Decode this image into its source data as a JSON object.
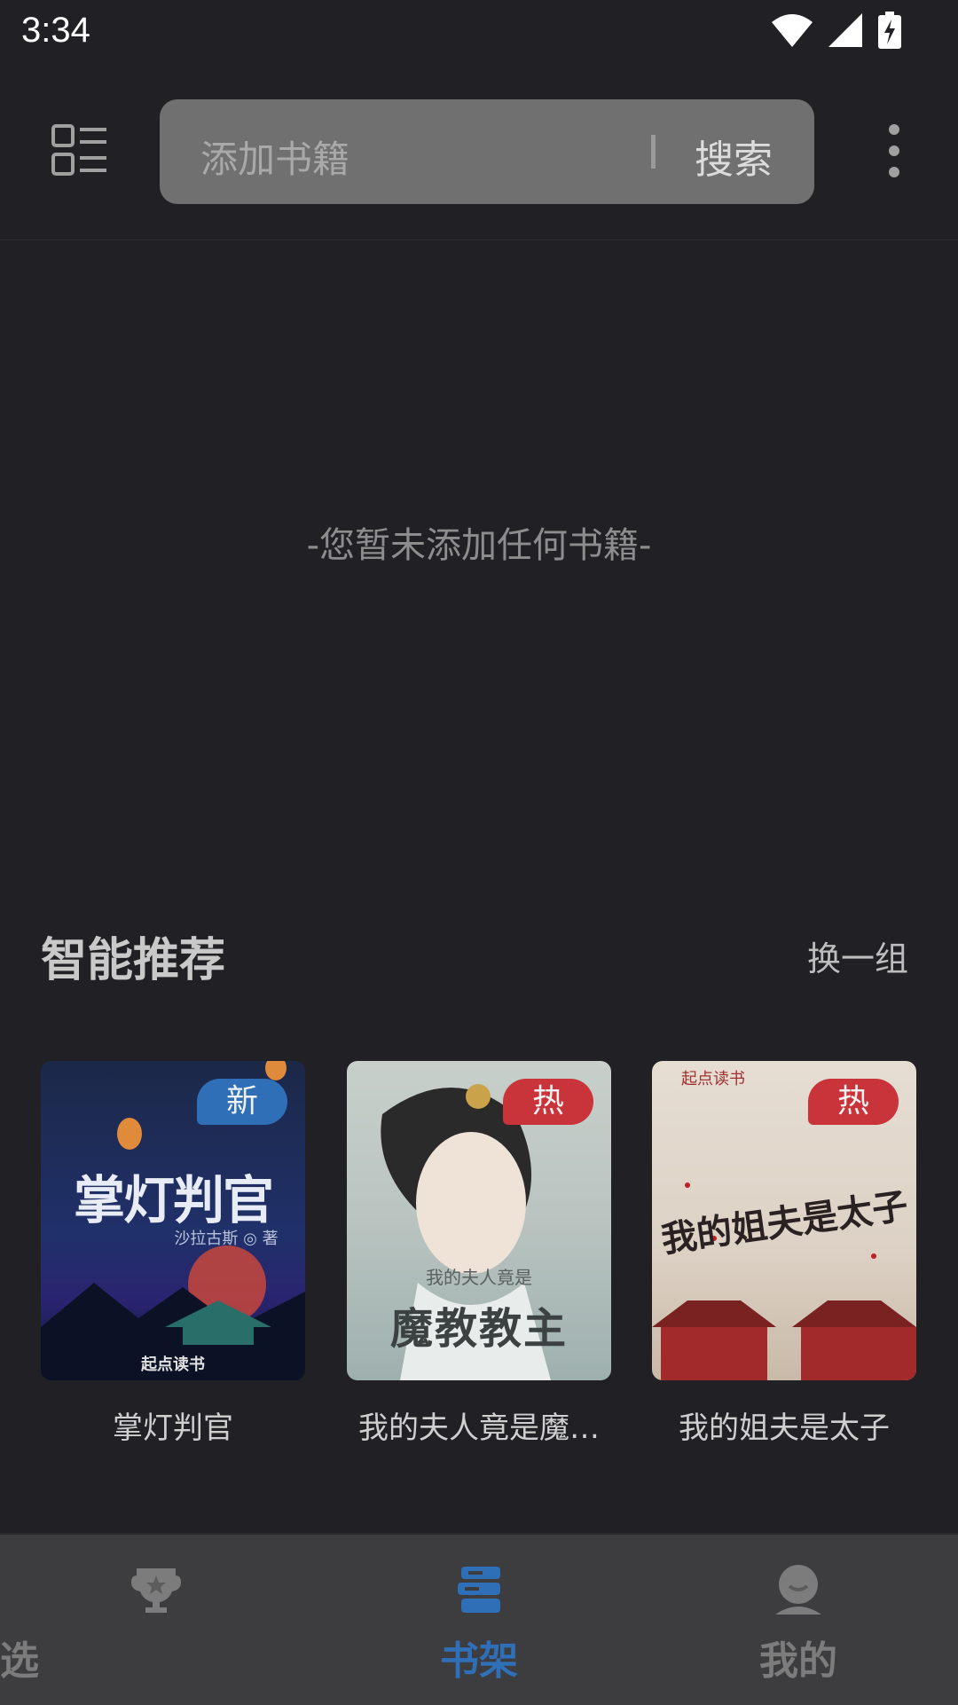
{
  "status_bar": {
    "time": "3:34"
  },
  "header": {
    "search_placeholder": "添加书籍",
    "search_button": "搜索"
  },
  "shelf": {
    "empty_message": "-您暂未添加任何书籍-"
  },
  "recommend": {
    "title": "智能推荐",
    "refresh_label": "换一组",
    "books": [
      {
        "title": "掌灯判官",
        "badge": "新",
        "badge_color": "#2f6fb8",
        "cover_title": "掌灯判官",
        "cover_author": "沙拉古斯 ◎ 著",
        "cover_publisher": "起点读书"
      },
      {
        "title": "我的夫人竟是魔…",
        "badge": "热",
        "badge_color": "#c9343a",
        "cover_title": "魔教教主",
        "cover_subtitle": "我的夫人竟是"
      },
      {
        "title": "我的姐夫是太子",
        "badge": "热",
        "badge_color": "#c9343a",
        "cover_title": "我的姐夫是太子",
        "cover_publisher": "起点读书"
      }
    ]
  },
  "bottom_nav": {
    "items": [
      {
        "label": "精选",
        "icon": "trophy-icon",
        "active": false
      },
      {
        "label": "书架",
        "icon": "bookshelf-icon",
        "active": true
      },
      {
        "label": "我的",
        "icon": "profile-icon",
        "active": false
      }
    ],
    "active_color": "#2f6fb8",
    "inactive_color": "#7c7c7c"
  }
}
